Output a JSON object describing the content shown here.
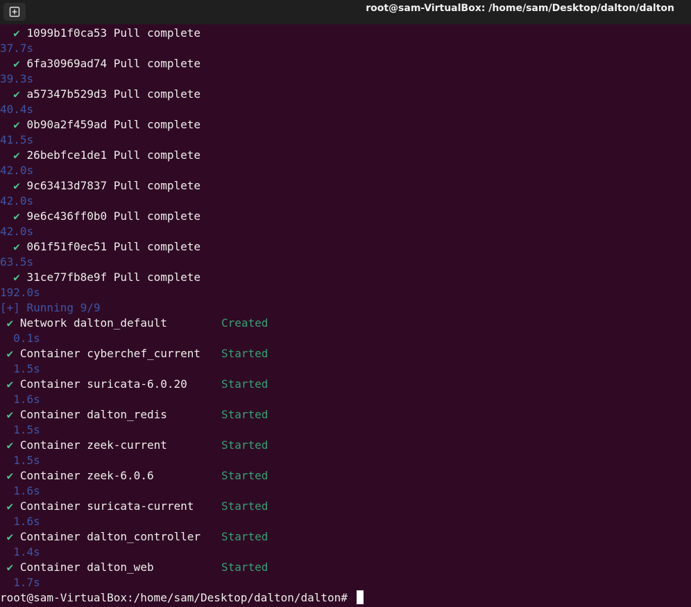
{
  "window": {
    "title": "root@sam-VirtualBox: /home/sam/Desktop/dalton/dalton",
    "new_tab_icon": "new-tab-icon"
  },
  "colors": {
    "background": "#300a24",
    "titlebar": "#1f1f1f",
    "check": "#4fc48e",
    "status": "#34a274",
    "timing": "#3d55a8"
  },
  "check_glyph": "✔",
  "pulls": [
    {
      "layer": "1099b1f0ca53",
      "status": "Pull complete",
      "time": "37.7s"
    },
    {
      "layer": "6fa30969ad74",
      "status": "Pull complete",
      "time": "39.3s"
    },
    {
      "layer": "a57347b529d3",
      "status": "Pull complete",
      "time": "40.4s"
    },
    {
      "layer": "0b90a2f459ad",
      "status": "Pull complete",
      "time": "41.5s"
    },
    {
      "layer": "26bebfce1de1",
      "status": "Pull complete",
      "time": "42.0s"
    },
    {
      "layer": "9c63413d7837",
      "status": "Pull complete",
      "time": "42.0s"
    },
    {
      "layer": "9e6c436ff0b0",
      "status": "Pull complete",
      "time": "42.0s"
    },
    {
      "layer": "061f51f0ec51",
      "status": "Pull complete",
      "time": "63.5s"
    },
    {
      "layer": "31ce77fb8e9f",
      "status": "Pull complete",
      "time": "192.0s"
    }
  ],
  "running_header": "[+] Running 9/9",
  "resources": [
    {
      "label": "Network dalton_default",
      "status": "Created",
      "time": "0.1s"
    },
    {
      "label": "Container cyberchef_current",
      "status": "Started",
      "time": "1.5s"
    },
    {
      "label": "Container suricata-6.0.20",
      "status": "Started",
      "time": "1.6s"
    },
    {
      "label": "Container dalton_redis",
      "status": "Started",
      "time": "1.5s"
    },
    {
      "label": "Container zeek-current",
      "status": "Started",
      "time": "1.5s"
    },
    {
      "label": "Container zeek-6.0.6",
      "status": "Started",
      "time": "1.6s"
    },
    {
      "label": "Container suricata-current",
      "status": "Started",
      "time": "1.6s"
    },
    {
      "label": "Container dalton_controller",
      "status": "Started",
      "time": "1.4s"
    },
    {
      "label": "Container dalton_web",
      "status": "Started",
      "time": "1.7s"
    }
  ],
  "prompt": "root@sam-VirtualBox:/home/sam/Desktop/dalton/dalton#"
}
